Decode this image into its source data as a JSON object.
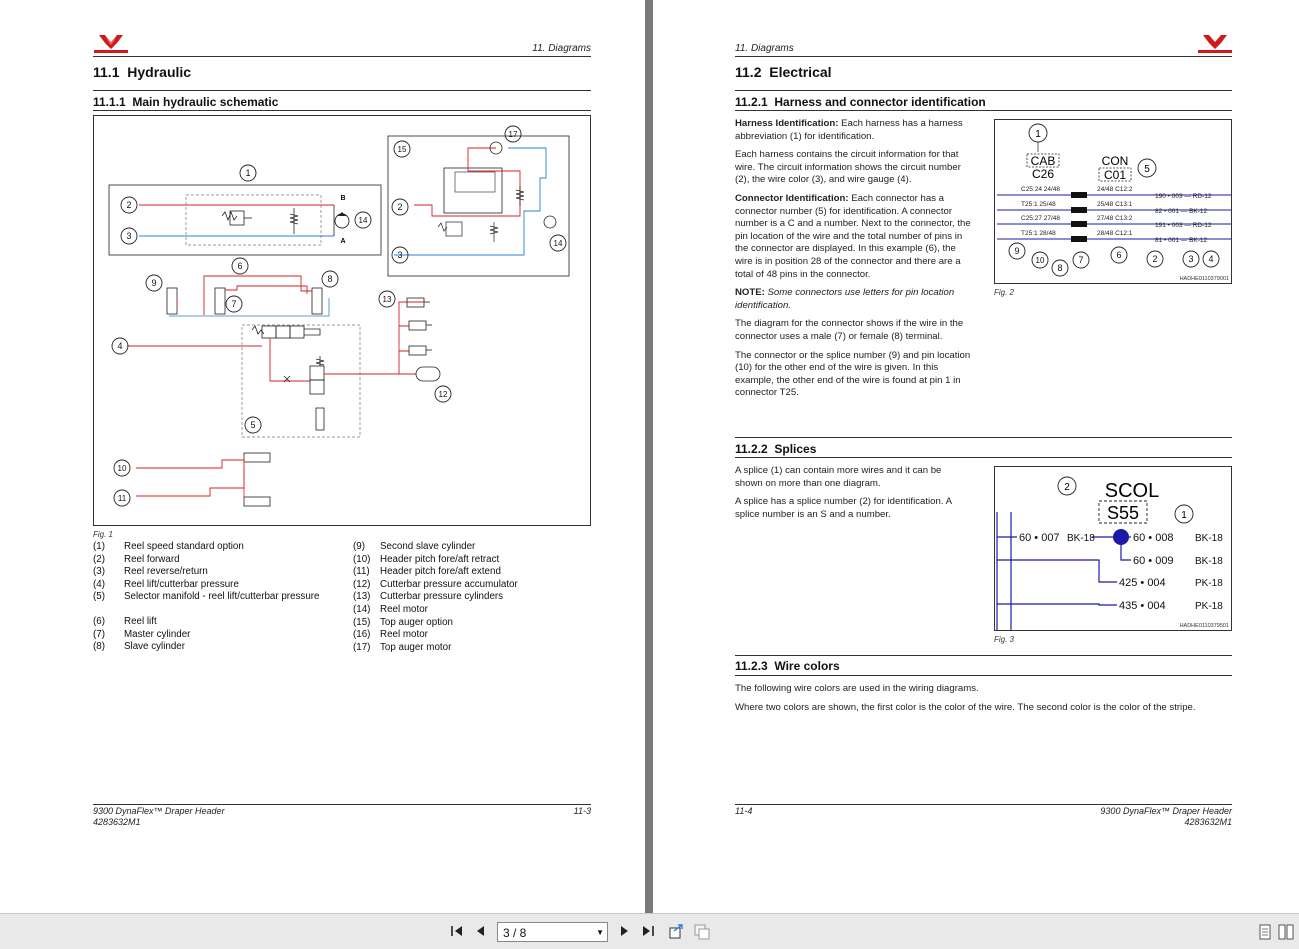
{
  "left": {
    "running_head": "11. Diagrams",
    "section_num": "11.1",
    "section_title": "Hydraulic",
    "sub_num": "11.1.1",
    "sub_title": "Main hydraulic schematic",
    "fig_caption": "Fig. 1",
    "legend_left": [
      {
        "n": "(1)",
        "t": "Reel speed standard option"
      },
      {
        "n": "(2)",
        "t": "Reel forward"
      },
      {
        "n": "(3)",
        "t": "Reel reverse/return"
      },
      {
        "n": "(4)",
        "t": "Reel lift/cutterbar pressure"
      },
      {
        "n": "(5)",
        "t": "Selector manifold - reel lift/cutterbar pressure"
      },
      {
        "n": "(6)",
        "t": "Reel lift"
      },
      {
        "n": "(7)",
        "t": "Master cylinder"
      },
      {
        "n": "(8)",
        "t": "Slave cylinder"
      }
    ],
    "legend_right": [
      {
        "n": "(9)",
        "t": "Second slave cylinder"
      },
      {
        "n": "(10)",
        "t": "Header pitch fore/aft retract"
      },
      {
        "n": "(11)",
        "t": "Header pitch fore/aft extend"
      },
      {
        "n": "(12)",
        "t": "Cutterbar pressure accumulator"
      },
      {
        "n": "(13)",
        "t": "Cutterbar pressure cylinders"
      },
      {
        "n": "(14)",
        "t": "Reel motor"
      },
      {
        "n": "(15)",
        "t": "Top auger option"
      },
      {
        "n": "(16)",
        "t": "Reel motor"
      },
      {
        "n": "(17)",
        "t": "Top auger motor"
      }
    ],
    "footer_title": "9300 DynaFlex™ Draper Header",
    "footer_part": "4283632M1",
    "footer_page": "11-3",
    "callouts": {
      "c1": "1",
      "c2": "2",
      "c3": "3",
      "c4": "4",
      "c5": "5",
      "c6": "6",
      "c7": "7",
      "c8": "8",
      "c9": "9",
      "c10": "10",
      "c11": "11",
      "c12": "12",
      "c13": "13",
      "c14": "14",
      "c15": "15",
      "c17": "17",
      "port_b": "B",
      "port_a": "A"
    }
  },
  "right": {
    "running_head": "11. Diagrams",
    "section_num": "11.2",
    "section_title": "Electrical",
    "s1_num": "11.2.1",
    "s1_title": "Harness and connector identification",
    "p1_bold": "Harness Identification:",
    "p1_text": " Each harness has a harness abbreviation (1) for identification.",
    "p2": "Each harness contains the circuit information for that wire. The circuit information shows the circuit number (2), the wire color (3), and wire gauge (4).",
    "p3_bold": "Connector Identification:",
    "p3_text": " Each connector has a connector number (5) for identification. A connector number is a C and a number. Next to the connector, the pin location of the wire and the total number of pins in the connector are displayed. In this example (6), the wire is in position 28 of the connector and there are a total of 48 pins in the connector.",
    "note_bold": "NOTE:",
    "note_text": " Some connectors use letters for pin location identification.",
    "p4": "The diagram for the connector shows if the wire in the connector uses a male (7) or female (8) terminal.",
    "p5": "The connector or the splice number (9) and pin location (10) for the other end of the wire is given. In this example, the other end of the wire is found at pin 1 in connector T25.",
    "fig2_caption": "Fig. 2",
    "fig2": {
      "cab": "CAB",
      "c26": "C26",
      "con": "CON",
      "c01": "C01",
      "rows_left": [
        "C25:24  24/48",
        "T25:1  25/48",
        "C25:27  27/48",
        "T25:1  28/48"
      ],
      "rows_mid": [
        "24/48  C12:2",
        "25/48  C13:1",
        "27/48  C13:2",
        "28/48  C12:1"
      ],
      "rows_right": [
        "190 • 003 — RD-12",
        "82 • 001 — BK-12",
        "191 • 003 — RD-12",
        "81 • 001 — BK-12"
      ],
      "code": "HADHE0110379001",
      "nums": {
        "n1": "1",
        "n2": "2",
        "n3": "3",
        "n4": "4",
        "n5": "5",
        "n6": "6",
        "n7": "7",
        "n8": "8",
        "n9": "9",
        "n10": "10"
      }
    },
    "s2_num": "11.2.2",
    "s2_title": "Splices",
    "p6": "A splice (1) can contain more wires and it can be shown on more than one diagram.",
    "p7": "A splice has a splice number (2) for identification. A splice number is an S and a number.",
    "fig3_caption": "Fig. 3",
    "fig3": {
      "scol": "SCOL",
      "s55": "S55",
      "w1": "60 • 007",
      "w1b": "BK-18",
      "w2": "60 • 008",
      "w2b": "BK-18",
      "w3": "60 • 009",
      "w3b": "BK-18",
      "w4": "425 • 004",
      "w4b": "PK-18",
      "w5": "435 • 004",
      "w5b": "PK-18",
      "code": "HADHE0110379501",
      "n1": "1",
      "n2": "2"
    },
    "s3_num": "11.2.3",
    "s3_title": "Wire colors",
    "p8": "The following wire colors are used in the wiring diagrams.",
    "p9": "Where two colors are shown, the first color is the color of the wire. The second color is the color of the stripe.",
    "footer_page": "11-4",
    "footer_title": "9300 DynaFlex™ Draper Header",
    "footer_part": "4283632M1"
  },
  "toolbar": {
    "page_indicator": "3 / 8"
  },
  "icons": [
    "first-page-icon",
    "prev-page-icon",
    "next-page-icon",
    "last-page-icon",
    "export-icon",
    "copy-icon",
    "single-page-icon",
    "two-page-icon"
  ],
  "colors": {
    "logo_red": "#d11a1a",
    "pressure_line": "#d42020",
    "return_line": "#2f7fd0",
    "wire_blue": "#1a1aa6"
  }
}
